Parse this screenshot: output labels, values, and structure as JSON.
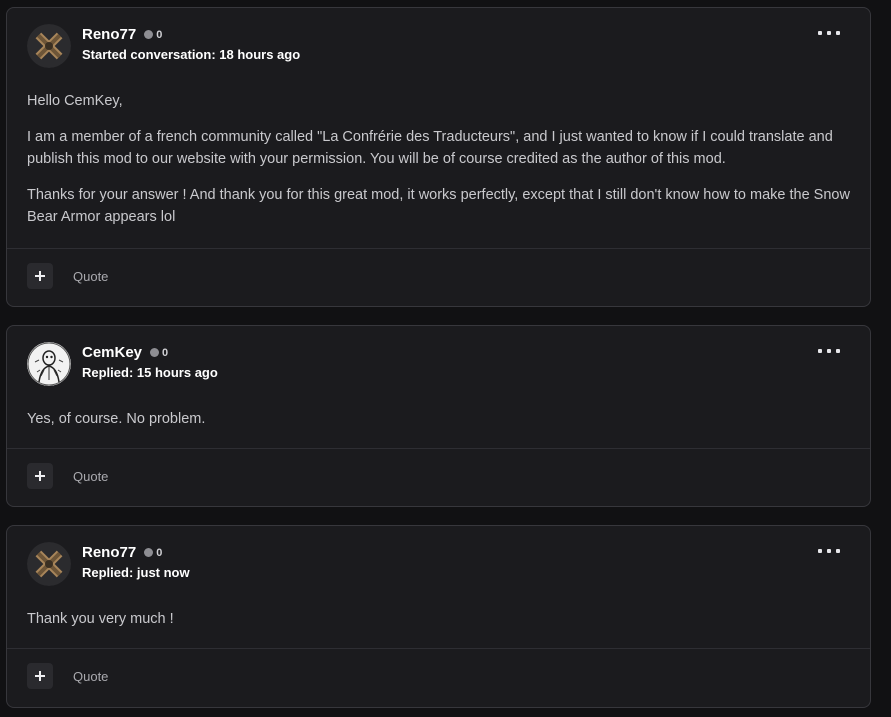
{
  "posts": [
    {
      "author": "Reno77",
      "kudos": "0",
      "meta": "Started conversation: 18 hours ago",
      "paragraphs": [
        "Hello CemKey,",
        "I am a member of a french community called \"La Confrérie des Traducteurs\", and I just wanted to know if I could translate and publish this mod to our website with your permission. You will be of course credited as the author of this mod.",
        "Thanks for your answer ! And thank you for this great mod, it works perfectly, except that I still don't know how to make the Snow Bear Armor appears lol"
      ],
      "quote_label": "Quote"
    },
    {
      "author": "CemKey",
      "kudos": "0",
      "meta": "Replied: 15 hours ago",
      "paragraphs": [
        "Yes, of course. No problem."
      ],
      "quote_label": "Quote"
    },
    {
      "author": "Reno77",
      "kudos": "0",
      "meta": "Replied: just now",
      "paragraphs": [
        "Thank you very much !"
      ],
      "quote_label": "Quote"
    }
  ],
  "icons": {
    "more": "more-options-icon",
    "add": "plus-icon",
    "kudos": "kudos-dot-icon"
  },
  "colors": {
    "page_bg": "#111113",
    "card_bg": "#1b1b1e",
    "card_border": "#37373c",
    "text": "#c9c9cd",
    "author": "#ffffff"
  }
}
